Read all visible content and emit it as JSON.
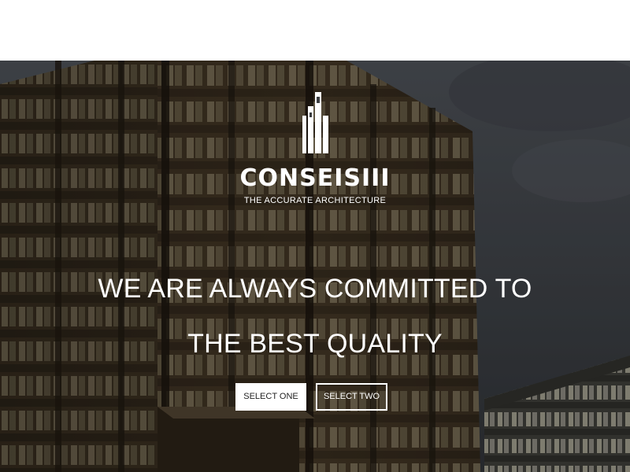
{
  "brand": {
    "name": "CONSEISIII",
    "tagline": "THE ACCURATE ARCHITECTURE",
    "logo_icon": "building-logo-icon"
  },
  "hero": {
    "headline_line1": "WE ARE ALWAYS COMMITTED TO",
    "headline_line2": "THE BEST QUALITY",
    "background": "building-photo"
  },
  "buttons": {
    "primary_label": "SELECT ONE",
    "secondary_label": "SELECT TWO"
  },
  "colors": {
    "text": "#ffffff",
    "primary_button_bg": "#ffffff",
    "primary_button_text": "#222222",
    "overlay": "#000000"
  }
}
